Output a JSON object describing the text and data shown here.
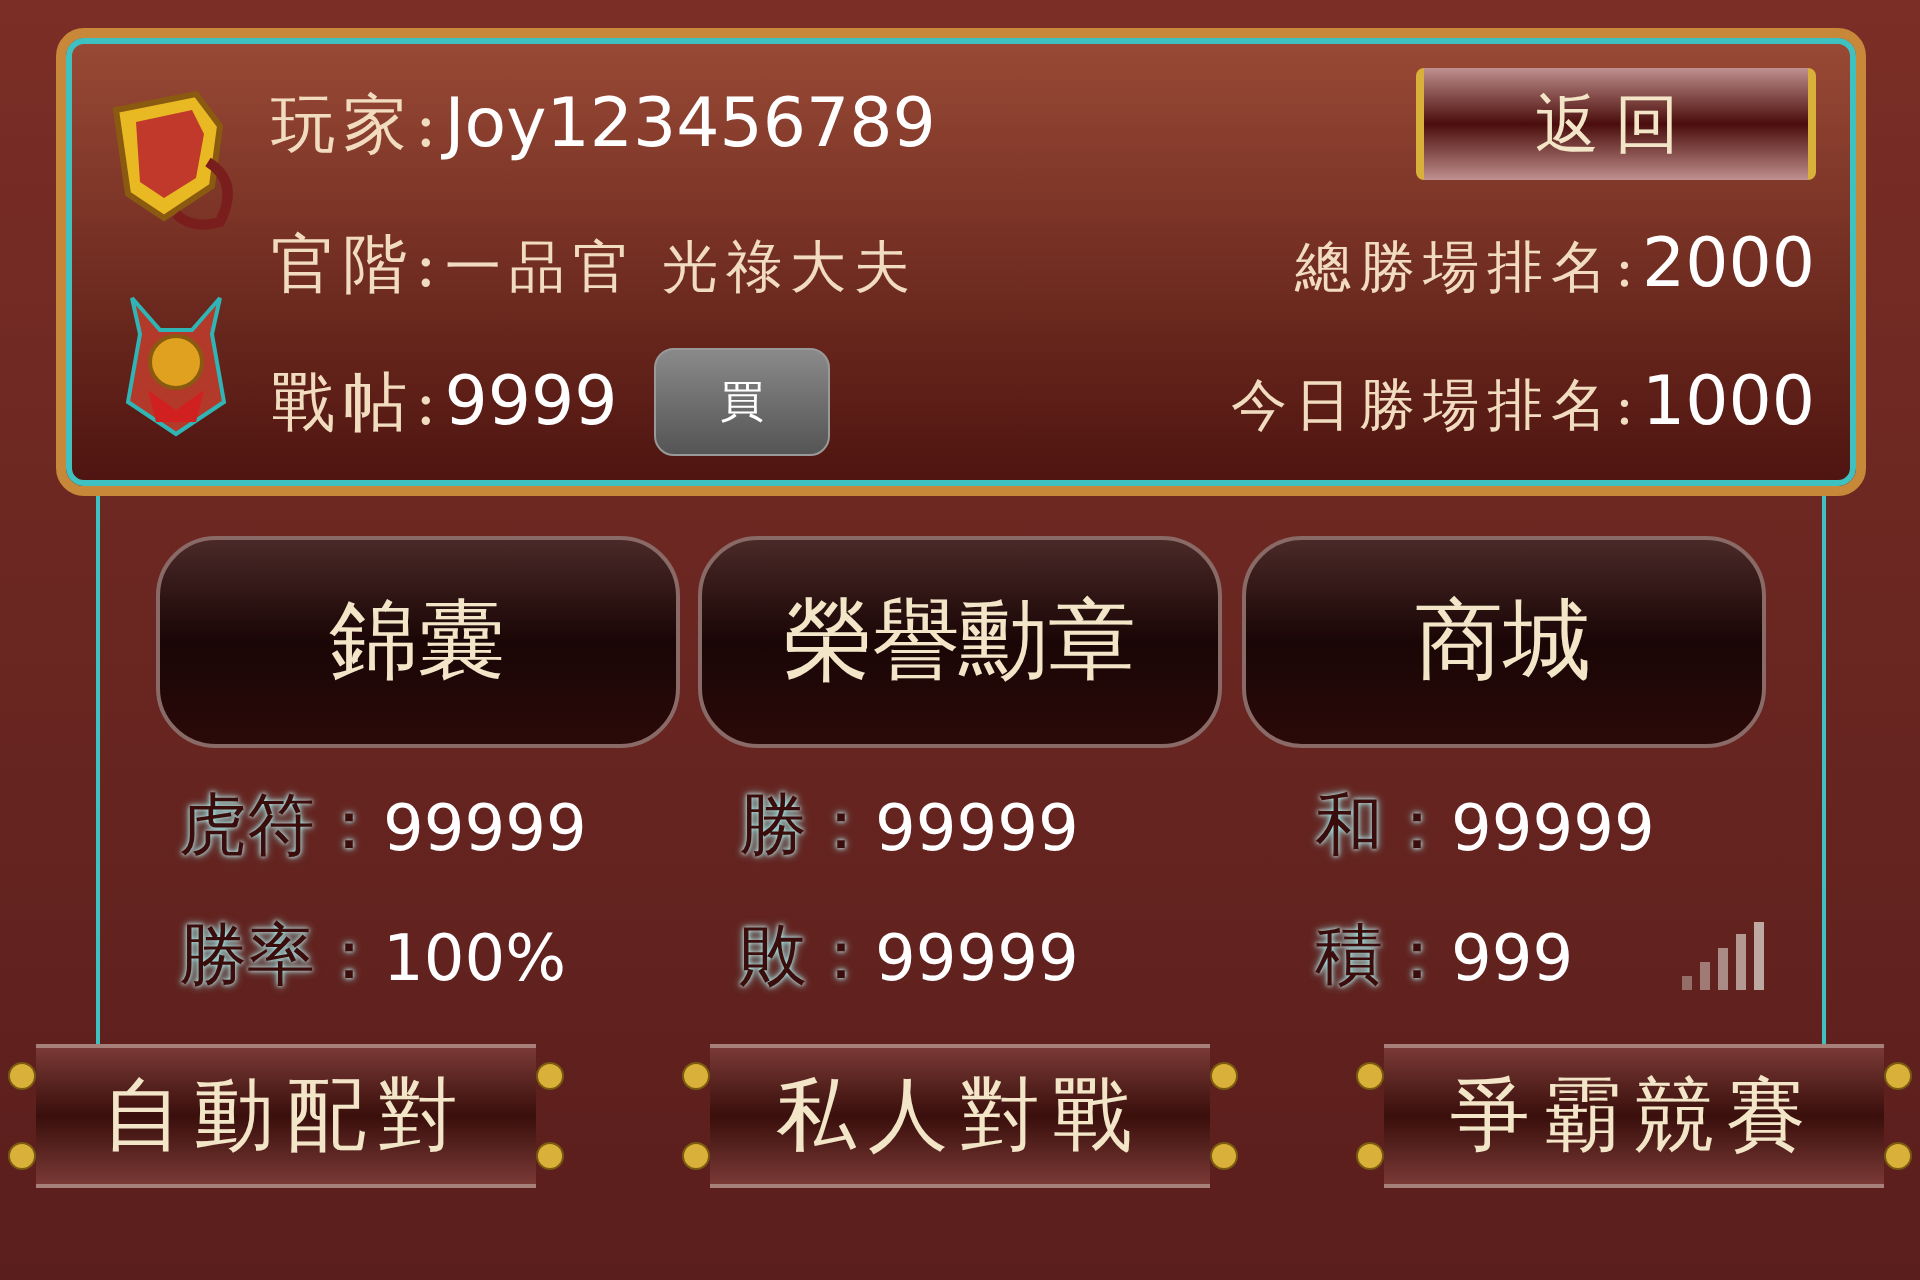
{
  "profile": {
    "fields": [
      {
        "label": "玩家:",
        "value": "Joy123456789"
      },
      {
        "label": "官階:",
        "value": "一品官 光祿大夫"
      },
      {
        "label": "戰帖:",
        "value": "9999"
      }
    ],
    "buy_button": "買",
    "back_button": "返回",
    "rankings": [
      {
        "label": "總勝場排名:",
        "value": "2000"
      },
      {
        "label": "今日勝場排名:",
        "value": "1000"
      }
    ]
  },
  "menu_buttons": [
    "錦囊",
    "榮譽勳章",
    "商城"
  ],
  "stats": [
    {
      "label": "虎符：",
      "value": "99999"
    },
    {
      "label": "勝：",
      "value": "99999"
    },
    {
      "label": "和：",
      "value": "99999"
    },
    {
      "label": "勝率：",
      "value": "100%"
    },
    {
      "label": "敗：",
      "value": "99999"
    },
    {
      "label": "積：",
      "value": "999"
    }
  ],
  "mode_buttons": [
    "自動配對",
    "私人對戰",
    "爭霸競賽"
  ]
}
